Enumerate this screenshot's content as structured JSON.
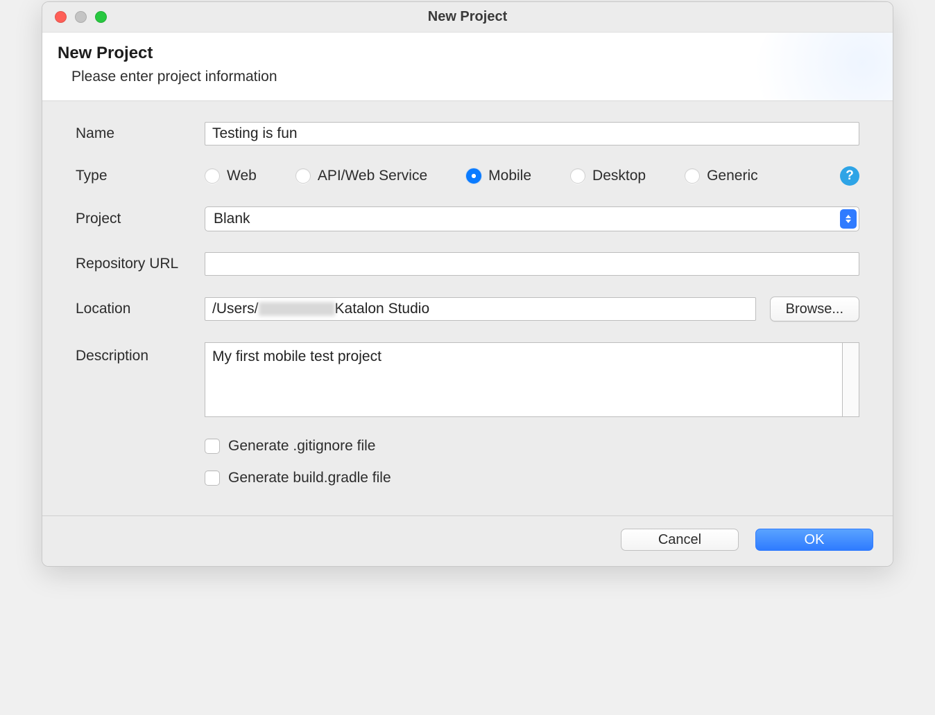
{
  "window": {
    "title": "New Project"
  },
  "banner": {
    "heading": "New Project",
    "subheading": "Please enter project information"
  },
  "labels": {
    "name": "Name",
    "type": "Type",
    "project": "Project",
    "repository_url": "Repository URL",
    "location": "Location",
    "description": "Description"
  },
  "fields": {
    "name_value": "Testing is fun",
    "repository_url_value": "",
    "location_prefix": "/Users/",
    "location_suffix": "Katalon Studio",
    "description_value": "My first mobile test project"
  },
  "type_options": {
    "web": "Web",
    "api": "API/Web Service",
    "mobile": "Mobile",
    "desktop": "Desktop",
    "generic": "Generic",
    "selected": "mobile"
  },
  "project_select": {
    "value": "Blank"
  },
  "checkboxes": {
    "gitignore": "Generate .gitignore file",
    "gradle": "Generate build.gradle file"
  },
  "buttons": {
    "browse": "Browse...",
    "cancel": "Cancel",
    "ok": "OK",
    "help": "?"
  }
}
